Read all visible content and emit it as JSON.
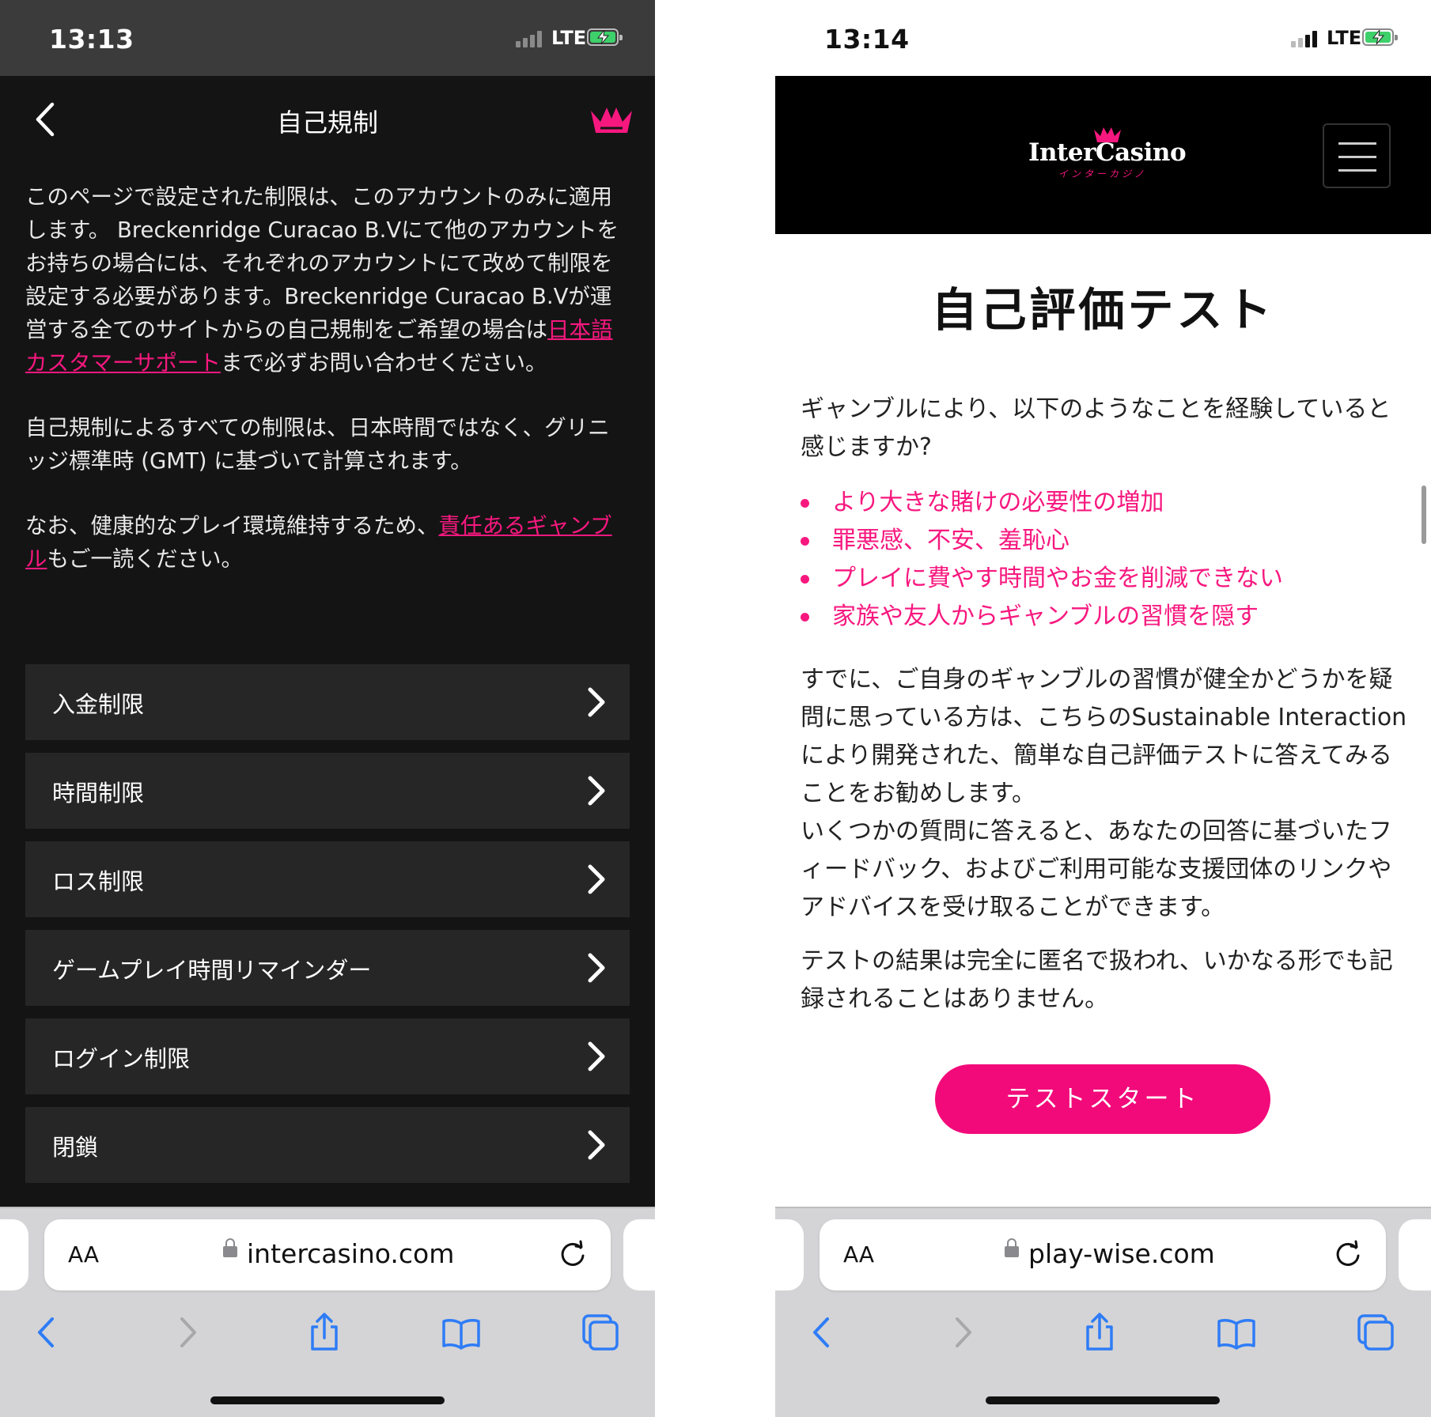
{
  "left_phone": {
    "status": {
      "time": "13:13",
      "network": "LTE"
    },
    "nav": {
      "title": "自己規制",
      "back_icon": "chevron-left-icon",
      "logo_icon": "crown-icon"
    },
    "paragraphs": {
      "p1_before": "このページで設定された制限は、このアカウントのみに適用します。 Breckenridge Curacao B.Vにて他のアカウントをお持ちの場合には、それぞれのアカウントにて改めて制限を設定する必要があります。Breckenridge Curacao B.Vが運営する全てのサイトからの自己規制をご希望の場合は",
      "p1_link": "日本語カスタマーサポート",
      "p1_after": "まで必ずお問い合わせください。",
      "p2": "自己規制によるすべての制限は、日本時間ではなく、グリニッジ標準時 (GMT) に基づいて計算されます。",
      "p3_before": "なお、健康的なプレイ環境維持するため、",
      "p3_link": "責任あるギャンブル",
      "p3_after": "もご一読ください。"
    },
    "menu": [
      {
        "label": "入金制限"
      },
      {
        "label": "時間制限"
      },
      {
        "label": "ロス制限"
      },
      {
        "label": "ゲームプレイ時間リマインダー"
      },
      {
        "label": "ログイン制限"
      },
      {
        "label": "閉鎖"
      }
    ],
    "safari": {
      "aa_label": "AA",
      "url": "intercasino.com"
    }
  },
  "right_phone": {
    "status": {
      "time": "13:14",
      "network": "LTE"
    },
    "header": {
      "logo_text": "InterCasino",
      "logo_sub": "インターカジノ",
      "menu_icon": "hamburger-icon"
    },
    "heading": "自己評価テスト",
    "question": "ギャンブルにより、以下のようなことを経験していると感じますか?",
    "bullets": [
      "より大きな賭けの必要性の増加",
      "罪悪感、不安、羞恥心",
      "プレイに費やす時間やお金を削減できない",
      "家族や友人からギャンブルの習慣を隠す"
    ],
    "body1": "すでに、ご自身のギャンブルの習慣が健全かどうかを疑問に思っている方は、こちらのSustainable Interactionにより開発された、簡単な自己評価テストに答えてみることをお勧めします。",
    "body2": "いくつかの質問に答えると、あなたの回答に基づいたフィードバック、およびご利用可能な支援団体のリンクやアドバイスを受け取ることができます。",
    "body3": "テストの結果は完全に匿名で扱われ、いかなる形でも記録されることはありません。",
    "start_button": "テストスタート",
    "safari": {
      "aa_label": "AA",
      "url": "play-wise.com"
    }
  },
  "colors": {
    "accent_pink": "#f7187f",
    "button_pink": "#f20a7a",
    "battery_green": "#3ed06a"
  }
}
